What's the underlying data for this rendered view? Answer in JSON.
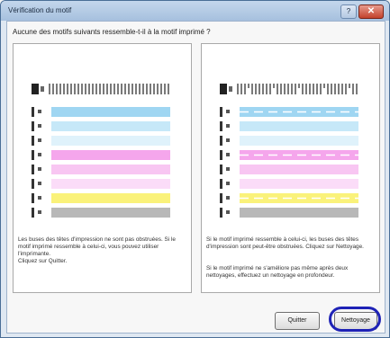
{
  "window": {
    "title": "Vérification du motif"
  },
  "question": "Aucune des motifs suivants ressemble-t-il à la motif imprimé ?",
  "colors": {
    "cyan": "#9fd6f2",
    "light_cyan": "#c6e8f8",
    "pale_cyan": "#dff2fb",
    "magenta": "#f5a6ec",
    "light_magenta": "#f8c6f2",
    "pale_magenta": "#fbdcf8",
    "yellow": "#faf27a",
    "gray": "#b8b8b8",
    "highlight": "#1e22b6"
  },
  "left_panel": {
    "text_1": "Les buses des têtes d'impression ne sont pas obstruées. Si le motif imprimé ressemble à celui-ci, vous pouvez utiliser l'imprimante.",
    "text_2": "Cliquez sur Quitter."
  },
  "right_panel": {
    "text_1": "Si le motif imprimé ressemble à celui-ci, les buses des têtes d'impression sont peut-être obstruées. Cliquez sur Nettoyage.",
    "text_2": "Si le motif imprimé ne s'améliore pas même après deux nettoyages, effectuez un nettoyage en profondeur."
  },
  "buttons": {
    "quit": "Quitter",
    "clean": "Nettoyage"
  }
}
